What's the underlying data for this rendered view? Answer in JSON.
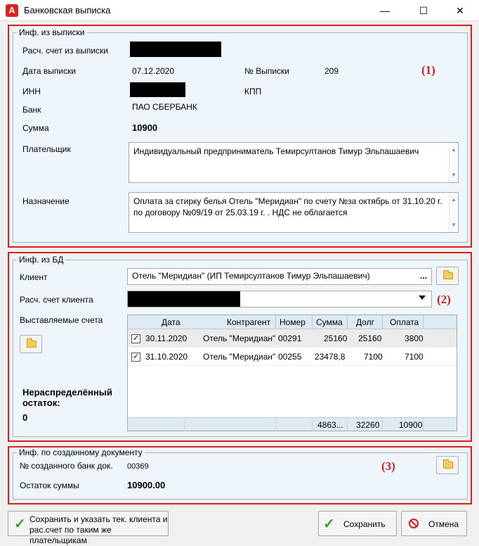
{
  "window": {
    "title": "Банковская выписка",
    "app_icon_letter": "A",
    "minimize": "—",
    "maximize": "☐",
    "close": "✕"
  },
  "section1": {
    "legend": "Инф. из выписки",
    "marker": "(1)",
    "account_label": "Расч. счет из выписки",
    "date_label": "Дата выписки",
    "date_value": "07.12.2020",
    "number_label": "№ Выписки",
    "number_value": "209",
    "inn_label": "ИНН",
    "kpp_label": "КПП",
    "bank_label": "Банк",
    "bank_value": "ПАО СБЕРБАНК",
    "sum_label": "Сумма",
    "sum_value": "10900",
    "payer_label": "Плательщик",
    "payer_value": "Индивидуальный предприниматель Темирсултанов Тимур Эльпашаевич",
    "purpose_label": "Назначение",
    "purpose_value": "Оплата за стирку белья Отель \"Меридиан\" по счету №за октябрь от 31.10.20 г. по договору №09/19 от 25.03.19 г. . НДС не облагается"
  },
  "section2": {
    "legend": "Инф. из БД",
    "marker": "(2)",
    "client_label": "Клиент",
    "client_value": "Отель \"Меридиан\" (ИП Темирсултанов Тимур Эльпашаевич)",
    "client_ellipsis": "...",
    "client_account_label": "Расч. счет клиента",
    "invoices_label": "Выставляемые счета",
    "unallocated_label_1": "Нераспределённый",
    "unallocated_label_2": "остаток:",
    "unallocated_value": "0",
    "grid": {
      "headers": [
        "Дата",
        "Контрагент",
        "Номер",
        "Сумма",
        "Долг",
        "Оплата"
      ],
      "rows": [
        {
          "checked": "✓",
          "date": "30.11.2020",
          "counterparty": "Отель \"Меридиан\"",
          "number": "00291",
          "sum": "25160",
          "debt": "25160",
          "payment": "3800"
        },
        {
          "checked": "✓",
          "date": "31.10.2020",
          "counterparty": "Отель \"Меридиан\"",
          "number": "00255",
          "sum": "23478,8",
          "debt": "7100",
          "payment": "7100"
        }
      ],
      "footer": {
        "sum": "4863...",
        "debt": "32260",
        "payment": "10900"
      }
    }
  },
  "section3": {
    "legend": "Инф. по созданному документу",
    "marker": "(3)",
    "doc_label": "№ созданного банк док.",
    "doc_value": "00369",
    "remainder_label": "Остаток суммы",
    "remainder_value": "10900.00"
  },
  "buttons": {
    "save_and_set_1": "Сохранить и указать тек. клиента и",
    "save_and_set_2": "рас.счет по таким же плательщикам",
    "save": "Сохранить",
    "cancel": "Отмена"
  }
}
